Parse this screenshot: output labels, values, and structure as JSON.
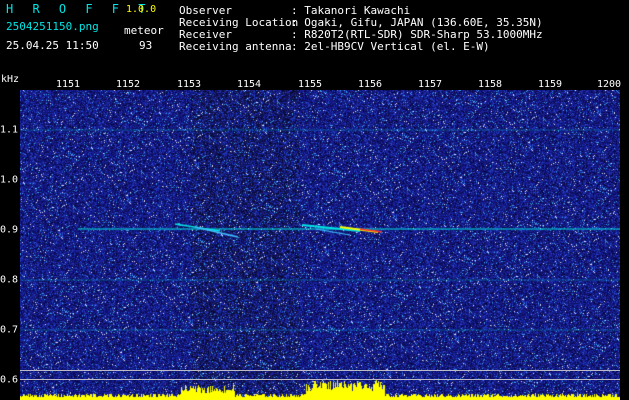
{
  "header": {
    "app_title": "H R O F F T",
    "version": "1.0.0",
    "filename": "2504251150.png",
    "datetime": "25.04.25 11:50",
    "mode_label": "meteor",
    "mode_count": "93"
  },
  "info": {
    "observer_label": "Observer",
    "observer_value": ": Takanori Kawachi",
    "location_label": "Receiving Location",
    "location_value": ": Ogaki, Gifu, JAPAN (136.60E, 35.35N)",
    "receiver_label": "Receiver",
    "receiver_value": ": R820T2(RTL-SDR) SDR-Sharp 53.1000MHz",
    "antenna_label": "Receiving antenna",
    "antenna_value": ": 2el-HB9CV Vertical (el. E-W)"
  },
  "axes": {
    "y_unit": "kHz",
    "x_ticks": [
      "1151",
      "1152",
      "1153",
      "1154",
      "1155",
      "1156",
      "1157",
      "1158",
      "1159",
      "1200"
    ],
    "y_ticks": [
      "1.1",
      "1.0",
      "0.9",
      "0.8",
      "0.7",
      "0.6"
    ]
  },
  "colors": {
    "background": "#000000",
    "header_text": "#00e5e5",
    "info_text": "#ffffff",
    "noise_base": "#1a1a80",
    "signal_line": "#00e5e5",
    "meteor_echo": "#ffff00",
    "meteor_core": "#ff3030",
    "bottom_band": "#ffff00"
  }
}
